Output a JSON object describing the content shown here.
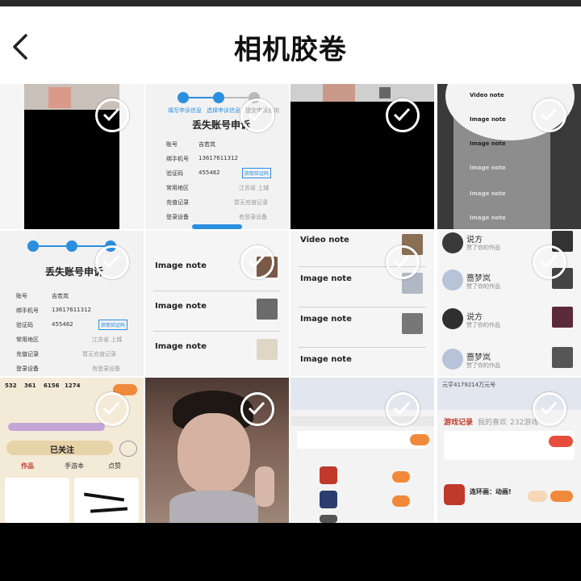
{
  "header": {
    "title": "相机胶卷",
    "back_icon": "chevron-left-icon"
  },
  "thumbnails": {
    "t2": {
      "title": "丢失账号申诉",
      "steps": [
        "填写申诉信息",
        "选择申诉信息",
        "提交申诉查询"
      ],
      "rows": [
        {
          "label": "账号",
          "value": "吉若岚"
        },
        {
          "label": "绑手机号",
          "value": "13617611312"
        },
        {
          "label": "验证码",
          "value": "455462"
        },
        {
          "label": "常用地区",
          "value": "江苏省 上城"
        },
        {
          "label": "充值记录",
          "value": "暂无充值记录"
        },
        {
          "label": "登录设备",
          "value": "有登录设备"
        }
      ],
      "code_button": "获取验证码"
    },
    "t4": {
      "items": [
        "Video note",
        "Image note",
        "Image note",
        "Image note",
        "Image note",
        "Image note"
      ]
    },
    "t5": {
      "title": "丢失账号申诉",
      "rows": [
        {
          "label": "账号",
          "value": "吉若岚"
        },
        {
          "label": "绑手机号",
          "value": "13617611312"
        },
        {
          "label": "验证码",
          "value": "455462"
        },
        {
          "label": "常用地区",
          "value": "江苏省 上城"
        },
        {
          "label": "充值记录",
          "value": "暂无充值记录"
        },
        {
          "label": "登录设备",
          "value": "有登录设备"
        }
      ],
      "code_button": "获取验证码"
    },
    "t6": {
      "items": [
        "Image note",
        "Image note",
        "Image note"
      ]
    },
    "t7": {
      "items": [
        "Video note",
        "Image note",
        "Image note",
        "Image note"
      ]
    },
    "t8": {
      "items": [
        {
          "name": "说方",
          "sub": "赞了你的作品"
        },
        {
          "name": "蔷梦岚",
          "sub": "赞了你的作品"
        },
        {
          "name": "说方",
          "sub": "赞了你的作品"
        },
        {
          "name": "蔷梦岚",
          "sub": "赞了你的作品"
        }
      ]
    },
    "t9": {
      "stats": [
        "532",
        "361",
        "6156",
        "1274"
      ],
      "follow_button": "已关注",
      "tabs": [
        "作品",
        "手游本",
        "点赞"
      ]
    },
    "t12": {
      "uid": "元亨4179214万元号",
      "tabs": [
        "游戏记录",
        "我的喜欢",
        "232游戏"
      ],
      "game": "连环画：动画!"
    }
  },
  "colors": {
    "accent": "#2b8fe0",
    "check": "#ffffff",
    "orange": "#f08a3a"
  }
}
